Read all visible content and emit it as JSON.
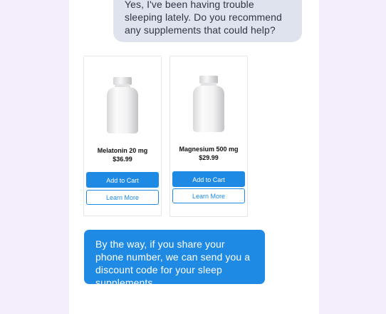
{
  "chat": {
    "user_message": "Yes, I've been having trouble sleeping lately. Do you recommend any supplements that could help?",
    "bot_message": "By the way, if you share your phone number, we can send you a discount code for your sleep supplements."
  },
  "products": [
    {
      "name": "Melatonin 20 mg",
      "price": "$36.99",
      "add_label": "Add to Cart",
      "more_label": "Learn More",
      "image_icon": "supplement-bottle-icon"
    },
    {
      "name": "Magnesium 500 mg",
      "price": "$29.99",
      "add_label": "Add to Cart",
      "more_label": "Learn More",
      "image_icon": "supplement-bottle-icon"
    }
  ],
  "colors": {
    "background": "#f4eefc",
    "user_bubble": "#dfe3ee",
    "accent": "#1f8ae4"
  }
}
